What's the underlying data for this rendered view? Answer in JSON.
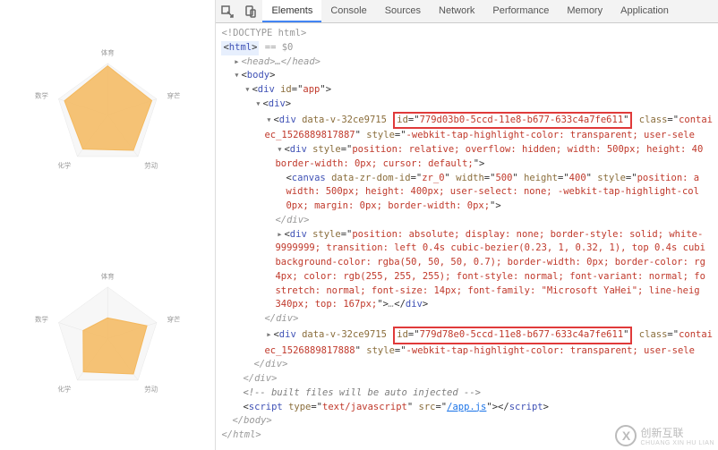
{
  "chart_data": [
    {
      "type": "radar",
      "labels": [
        "体育",
        "穿芒",
        "劳动",
        "化学",
        "数学"
      ],
      "values": [
        95,
        90,
        85,
        82,
        88
      ],
      "max": 100,
      "fill": "#f4b95e",
      "tooltip": ""
    },
    {
      "type": "radar",
      "labels": [
        "体育",
        "穿芒",
        "劳动",
        "化学",
        "数学"
      ],
      "values": [
        40,
        80,
        85,
        80,
        50
      ],
      "max": 100,
      "fill": "#f4b85e",
      "tooltip": ""
    }
  ],
  "devtools": {
    "tabs": [
      "Elements",
      "Console",
      "Sources",
      "Network",
      "Performance",
      "Memory",
      "Application"
    ],
    "active_tab": "Elements",
    "doctype": "<!DOCTYPE html>",
    "selected_suffix": "== $0",
    "lines": {
      "html_open": "html",
      "head_closed": "<head>…</head>",
      "body": "body",
      "app_div": "div",
      "app_id": "app",
      "inner_div": "div",
      "data_v_attr": "data-v-32ce9715",
      "id_attr1": "779d03b0-5ccd-11e8-b677-633c4a7fe611",
      "id_attr2": "779d78e0-5ccd-11e8-b677-633c4a7fe611",
      "class_attr": "contai",
      "ec_class1": "ec_1526889817887",
      "ec_class2": "ec_1526889817888",
      "style_webkit": "-webkit-tap-highlight-color: transparent; user-sele",
      "div_style_rel": "position: relative; overflow: hidden; width: 500px; height: 40",
      "border_cursor": "border-width: 0px; cursor: default;",
      "canvas": "canvas",
      "zr_dom": "data-zr-dom-id",
      "zr_0": "zr_0",
      "w500": "500",
      "h400": "400",
      "canvas_style": "position: a",
      "canvas_style2": "width: 500px; height: 400px; user-select: none; -webkit-tap-highlight-col",
      "canvas_style3": "0px; margin: 0px; border-width: 0px;",
      "tooltip_style": "position: absolute; display: none; border-style: solid; white-",
      "tooltip_z": "9999999; transition: left 0.4s cubic-bezier(0.23, 1, 0.32, 1), top 0.4s cubi",
      "tooltip_bg": "background-color: rgba(50, 50, 50, 0.7); border-width: 0px; border-color: rg",
      "tooltip_font1": "4px; color: rgb(255, 255, 255); font-style: normal; font-variant: normal; fo",
      "tooltip_font2": "stretch: normal; font-size: 14px; font-family: \"Microsoft YaHei\"; line-heig",
      "tooltip_pos": "340px; top: 167px;",
      "close_div": "</div>",
      "comment_inject": "<!-- built files will be auto injected -->",
      "script_tag": "script",
      "script_type": "text/javascript",
      "script_src_label": "src",
      "script_src": "/app.js",
      "close_body": "</body>",
      "close_html": "</html>"
    }
  },
  "brand": {
    "logo": "X",
    "cn": "创新互联",
    "en": "CHUANG XIN HU LIAN"
  }
}
